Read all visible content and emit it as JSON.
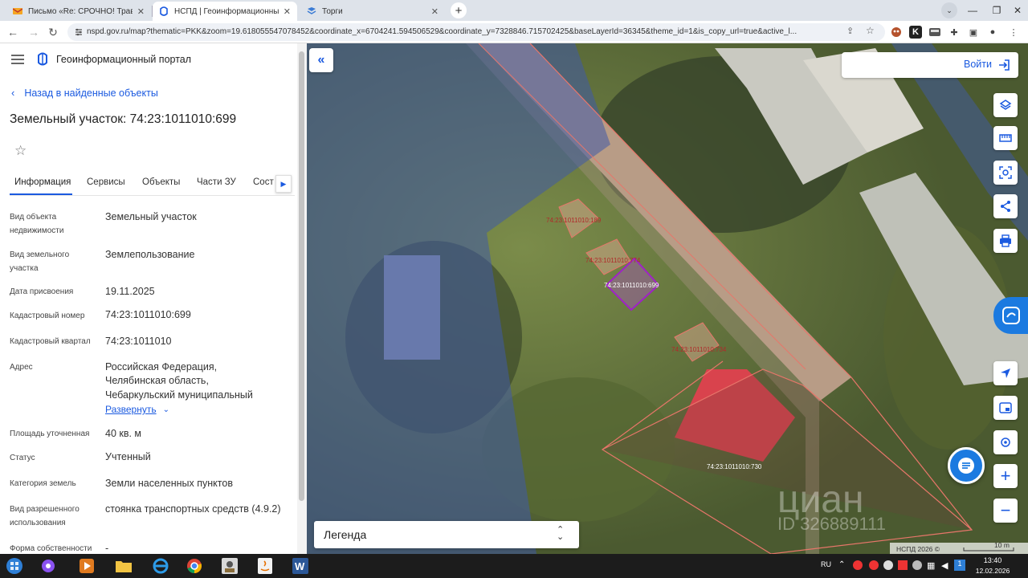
{
  "browser": {
    "tabs": [
      {
        "title": "Письмо «Re: СРОЧНО! Травоя",
        "icon": "mail-icon"
      },
      {
        "title": "НСПД | Геоинформационный п",
        "icon": "nspd-icon",
        "active": true
      },
      {
        "title": "Торги",
        "icon": "torgi-icon"
      }
    ],
    "url": "nspd.gov.ru/map?thematic=PKK&zoom=19.618055547078452&coordinate_x=6704241.594506529&coordinate_y=7328846.715702425&baseLayerId=36345&theme_id=1&is_copy_url=true&active_l..."
  },
  "portal": {
    "title": "Геоинформационный портал",
    "back_link": "Назад в найденные объекты",
    "object_title": "Земельный участок: 74:23:1011010:699"
  },
  "tabs": [
    "Информация",
    "Сервисы",
    "Объекты",
    "Части ЗУ",
    "Соста"
  ],
  "info": {
    "object_type_label": "Вид объекта недвижимости",
    "object_type_value": "Земельный участок",
    "land_type_label": "Вид земельного участка",
    "land_type_value": "Землепользование",
    "date_label": "Дата присвоения",
    "date_value": "19.11.2025",
    "cad_num_label": "Кадастровый номер",
    "cad_num_value": "74:23:1011010:699",
    "cad_quarter_label": "Кадастровый квартал",
    "cad_quarter_value": "74:23:1011010",
    "address_label": "Адрес",
    "address_line1": "Российская Федерация,",
    "address_line2": "Челябинская область,",
    "address_line3": "Чебаркульский муниципальный",
    "expand_label": "Развернуть",
    "area_label": "Площадь уточненная",
    "area_value": "40 кв. м",
    "status_label": "Статус",
    "status_value": "Учтенный",
    "category_label": "Категория земель",
    "category_value": "Земли населенных пунктов",
    "use_label": "Вид разрешенного использования",
    "use_value": "стоянка транспортных средств (4.9.2)",
    "ownership_label": "Форма собственности",
    "ownership_value": "-"
  },
  "map": {
    "login_label": "Войти",
    "legend_label": "Легенда",
    "parcels": [
      "74:23:1011010:189",
      "74:23:1011010:774",
      "74:23:1011010:699",
      "74:23:1011010:734",
      "74:23:1011010:730"
    ],
    "attribution": "НСПД 2026 ©",
    "scale": "10 m",
    "watermark_brand": "циан",
    "watermark_id": "ID 326889111"
  },
  "taskbar": {
    "lang": "RU",
    "time": "13:40",
    "date": "12.02.2026"
  }
}
